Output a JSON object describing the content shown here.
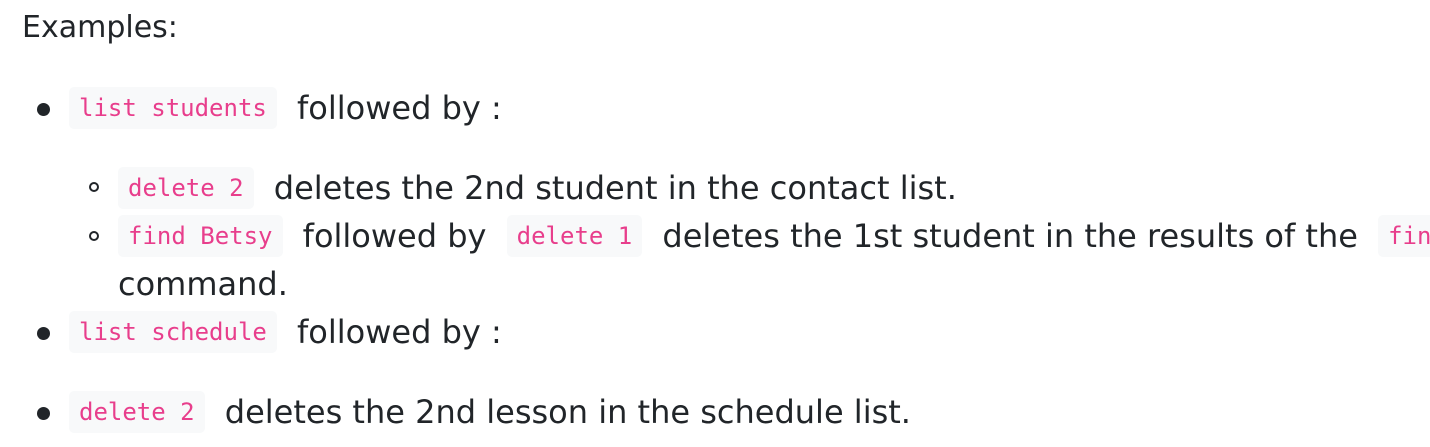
{
  "heading": "Examples:",
  "items": [
    {
      "code": "list students",
      "text": " followed by :",
      "subitems": [
        {
          "code": "delete 2",
          "text": " deletes the 2nd student in the contact list."
        },
        {
          "code": "find Betsy",
          "text1": " followed by ",
          "code2": "delete 1",
          "text2": " deletes the 1st student in the results of the ",
          "code3": "find",
          "text3": "command."
        }
      ]
    },
    {
      "code": "list schedule",
      "text": " followed by :"
    },
    {
      "code": "delete 2",
      "text": " deletes the 2nd lesson in the schedule list."
    }
  ]
}
